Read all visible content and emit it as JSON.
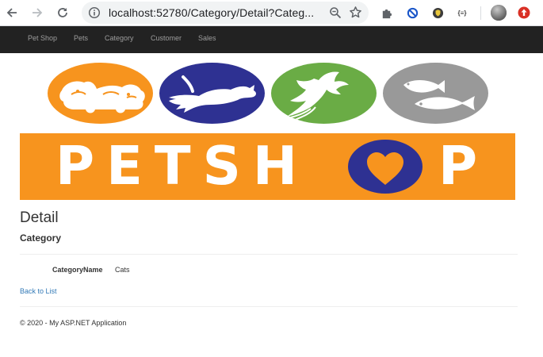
{
  "browser": {
    "url": "localhost:52780/Category/Detail?Categ...",
    "icons": [
      "back-arrow-icon",
      "forward-arrow-icon",
      "reload-icon",
      "info-icon",
      "zoom-icon",
      "star-icon",
      "puzzle-icon",
      "block-icon",
      "shield-icon",
      "json-icon",
      "profile-avatar",
      "update-icon"
    ],
    "json_ext_label": "{≡}"
  },
  "navbar": {
    "items": [
      "Pet Shop",
      "Pets",
      "Category",
      "Customer",
      "Sales"
    ]
  },
  "banner": {
    "logo_left": "PETSH",
    "logo_right": "P",
    "colors": {
      "orange": "#f7941e",
      "navy": "#2e3192",
      "green": "#6aac45",
      "gray": "#999999"
    }
  },
  "page": {
    "title": "Detail",
    "subtitle": "Category"
  },
  "details": {
    "label": "CategoryName",
    "value": "Cats"
  },
  "links": {
    "back": "Back to List"
  },
  "footer": {
    "text": "© 2020 - My ASP.NET Application"
  }
}
